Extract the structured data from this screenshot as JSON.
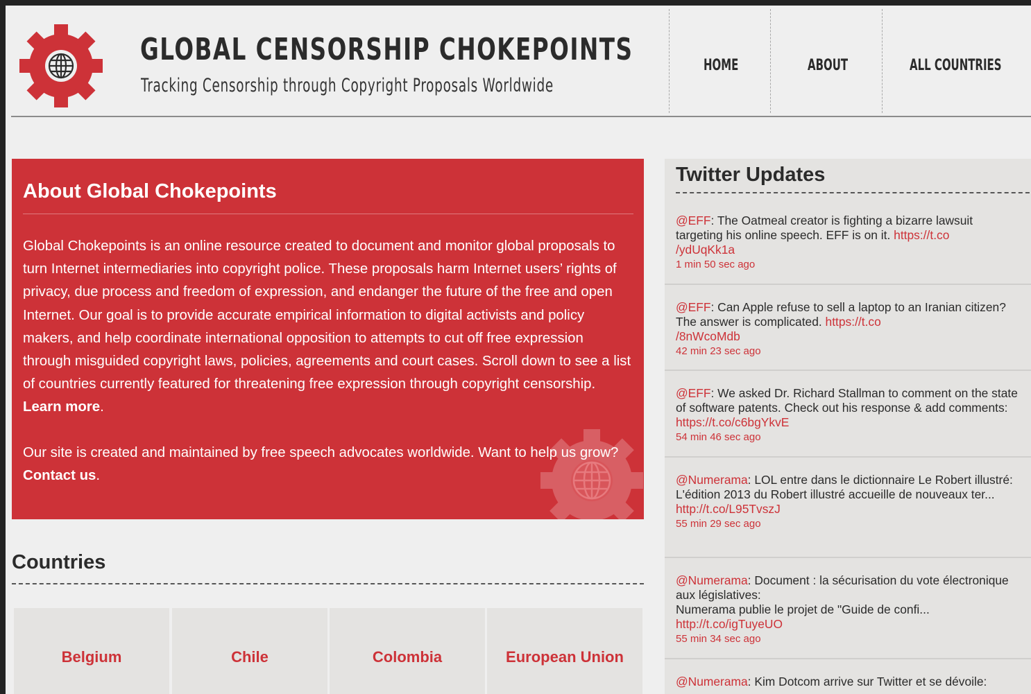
{
  "header": {
    "title": "GLOBAL CENSORSHIP CHOKEPOINTS",
    "tagline": "Tracking Censorship through Copyright Proposals Worldwide"
  },
  "nav": [
    {
      "label": "HOME"
    },
    {
      "label": "ABOUT"
    },
    {
      "label": "ALL COUNTRIES"
    }
  ],
  "about": {
    "title": "About Global Chokepoints",
    "body": "Global Chokepoints is an online resource created to document and monitor global proposals to turn Internet intermediaries into copyright police. These proposals harm Internet users’ rights of privacy, due process and freedom of expression, and endanger the future of the free and open Internet. Our goal is to provide accurate empirical information to digital activists and policy makers, and help coordinate international opposition to attempts to cut off free expression through misguided copyright laws, policies, agreements and court cases. Scroll down to see a list of countries currently featured for threatening free expression through copyright censorship.",
    "learn_more": "Learn more",
    "body2": "Our site is created and maintained by free speech advocates worldwide. Want to help us grow?",
    "contact": "Contact us"
  },
  "countries": {
    "title": "Countries",
    "items": [
      "Belgium",
      "Chile",
      "Colombia",
      "European Union"
    ]
  },
  "twitter": {
    "title": "Twitter Updates",
    "tweets": [
      {
        "user": "@EFF",
        "text": " The Oatmeal creator is fighting a bizarre lawsuit targeting his online speech. EFF is on it. ",
        "link": "https://t.co\n/ydUqKk1a",
        "time": "1 min 50 sec ago"
      },
      {
        "user": "@EFF",
        "text": " Can Apple refuse to sell a laptop to an Iranian citizen? The answer is complicated. ",
        "link": "https://t.co\n/8nWcoMdb",
        "time": "42 min 23 sec ago"
      },
      {
        "user": "@EFF",
        "text": " We asked Dr. Richard Stallman to comment on the state of software patents. Check out his response & add comments: ",
        "link": "https://t.co/c6bgYkvE",
        "time": "54 min 46 sec ago"
      },
      {
        "user": "@Numerama",
        "text": " LOL entre dans le dictionnaire Le Robert illustré:\nL'édition 2013 du Robert illustré accueille de nouveaux ter... ",
        "link": "http://t.co/L95TvszJ",
        "time": "55 min 29 sec ago"
      },
      {
        "user": "@Numerama",
        "text": " Document : la sécurisation du vote électronique aux législatives:\nNumerama publie le projet de \"Guide de confi...\n",
        "link": "http://t.co/igTuyeUO",
        "time": "55 min 34 sec ago"
      },
      {
        "user": "@Numerama",
        "text": " Kim Dotcom arrive sur Twitter et se dévoile:",
        "link": "",
        "time": ""
      }
    ]
  },
  "colors": {
    "accent": "#cd3238",
    "page_bg": "#efefef",
    "panel_bg": "#e4e3e1",
    "frame": "#232323",
    "text": "#2b2b2b"
  },
  "icons": {
    "logo": "gear-globe-icon",
    "watermark": "gear-globe-icon"
  }
}
